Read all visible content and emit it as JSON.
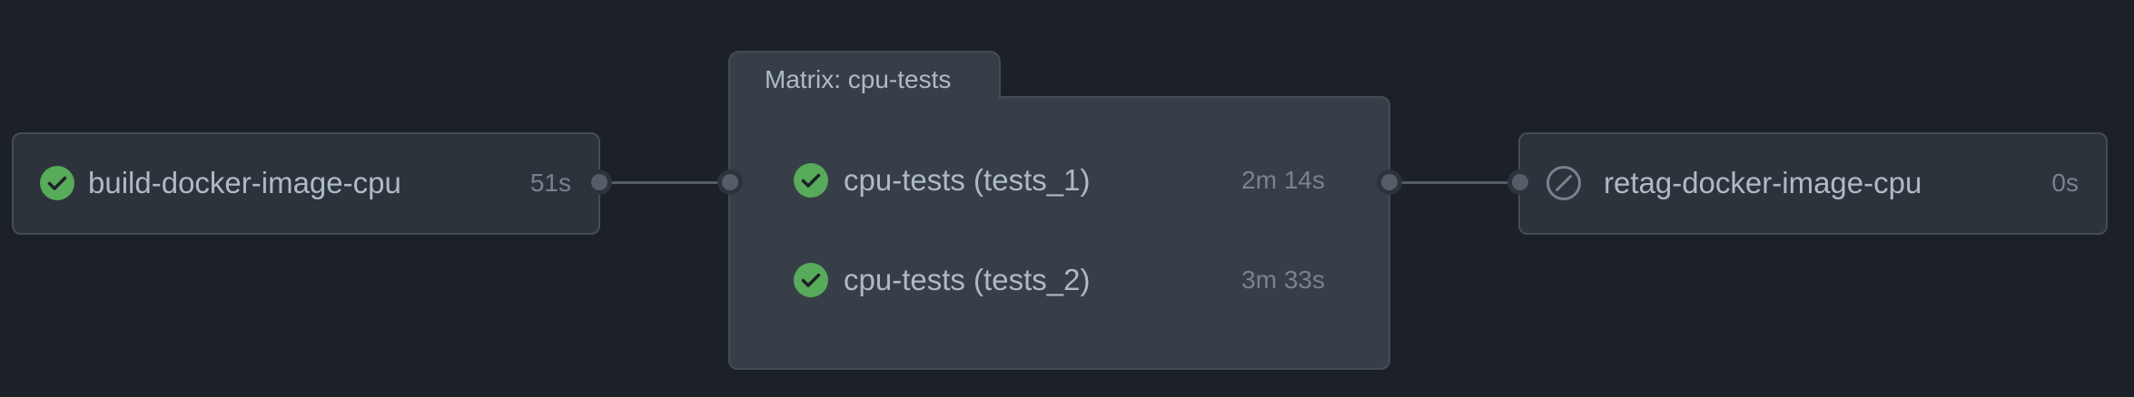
{
  "workflow_graph": {
    "jobs": [
      {
        "name": "build-docker-image-cpu",
        "duration": "51s",
        "status": "success",
        "status_icon": "check-circle-icon"
      },
      {
        "name": "retag-docker-image-cpu",
        "duration": "0s",
        "status": "skipped",
        "status_icon": "skipped-icon"
      }
    ],
    "matrix": {
      "title": "Matrix: cpu-tests",
      "jobs": [
        {
          "name": "cpu-tests (tests_1)",
          "duration": "2m 14s",
          "status": "success",
          "status_icon": "check-circle-icon"
        },
        {
          "name": "cpu-tests (tests_2)",
          "duration": "3m 33s",
          "status": "success",
          "status_icon": "check-circle-icon"
        }
      ]
    },
    "colors": {
      "background": "#1c2128",
      "card": "#2d333b",
      "matrix_card": "#373e47",
      "success": "#57ab5a",
      "text": "#adbac7",
      "muted": "#768390",
      "connector": "#545d68"
    }
  }
}
